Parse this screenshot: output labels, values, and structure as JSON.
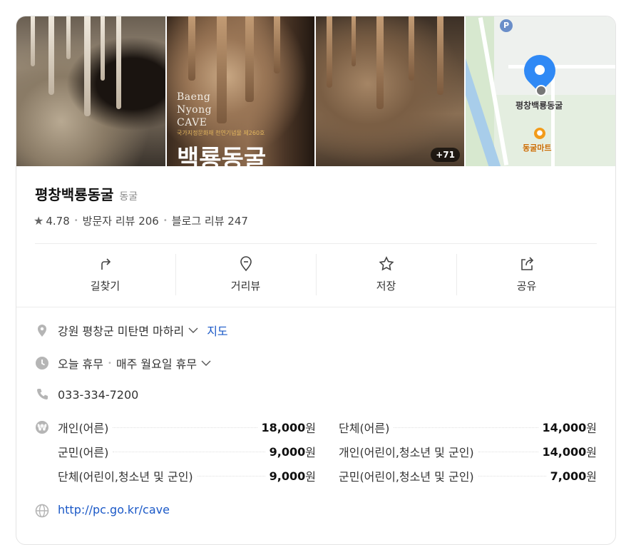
{
  "photos": {
    "cave_en_lines": [
      "Baeng",
      "Nyong",
      "CAVE"
    ],
    "cave_subtitle": "국가지정문화재 천연기념물 제260호",
    "cave_kr": "백룡동굴",
    "more_badge": "+71",
    "map": {
      "parking_glyph": "P",
      "pin_label": "평창백룡동굴",
      "poi_label": "동굴마트"
    }
  },
  "place": {
    "name": "평창백룡동굴",
    "category": "동굴",
    "rating": "4.78",
    "visitor_reviews": "방문자 리뷰 206",
    "blog_reviews": "블로그 리뷰 247"
  },
  "actions": [
    {
      "label": "길찾기",
      "icon": "directions-icon"
    },
    {
      "label": "거리뷰",
      "icon": "street-view-icon"
    },
    {
      "label": "저장",
      "icon": "star-icon"
    },
    {
      "label": "공유",
      "icon": "share-icon"
    }
  ],
  "info": {
    "address": "강원 평창군 미탄면 마하리",
    "map_link": "지도",
    "hours_status": "오늘 휴무",
    "hours_detail": "매주 월요일 휴무",
    "phone": "033-334-7200",
    "website": "http://pc.go.kr/cave"
  },
  "prices": [
    {
      "left": {
        "label": "개인(어른)",
        "value": "18,000",
        "unit": "원"
      },
      "right": {
        "label": "단체(어른)",
        "value": "14,000",
        "unit": "원"
      }
    },
    {
      "left": {
        "label": "군민(어른)",
        "value": "9,000",
        "unit": "원"
      },
      "right": {
        "label": "개인(어린이,청소년 및 군인)",
        "value": "14,000",
        "unit": "원"
      }
    },
    {
      "left": {
        "label": "단체(어린이,청소년 및 군인)",
        "value": "9,000",
        "unit": "원"
      },
      "right": {
        "label": "군민(어린이,청소년 및 군인)",
        "value": "7,000",
        "unit": "원"
      }
    }
  ],
  "colors": {
    "link": "#1a58c7",
    "pin": "#2f89f5"
  }
}
